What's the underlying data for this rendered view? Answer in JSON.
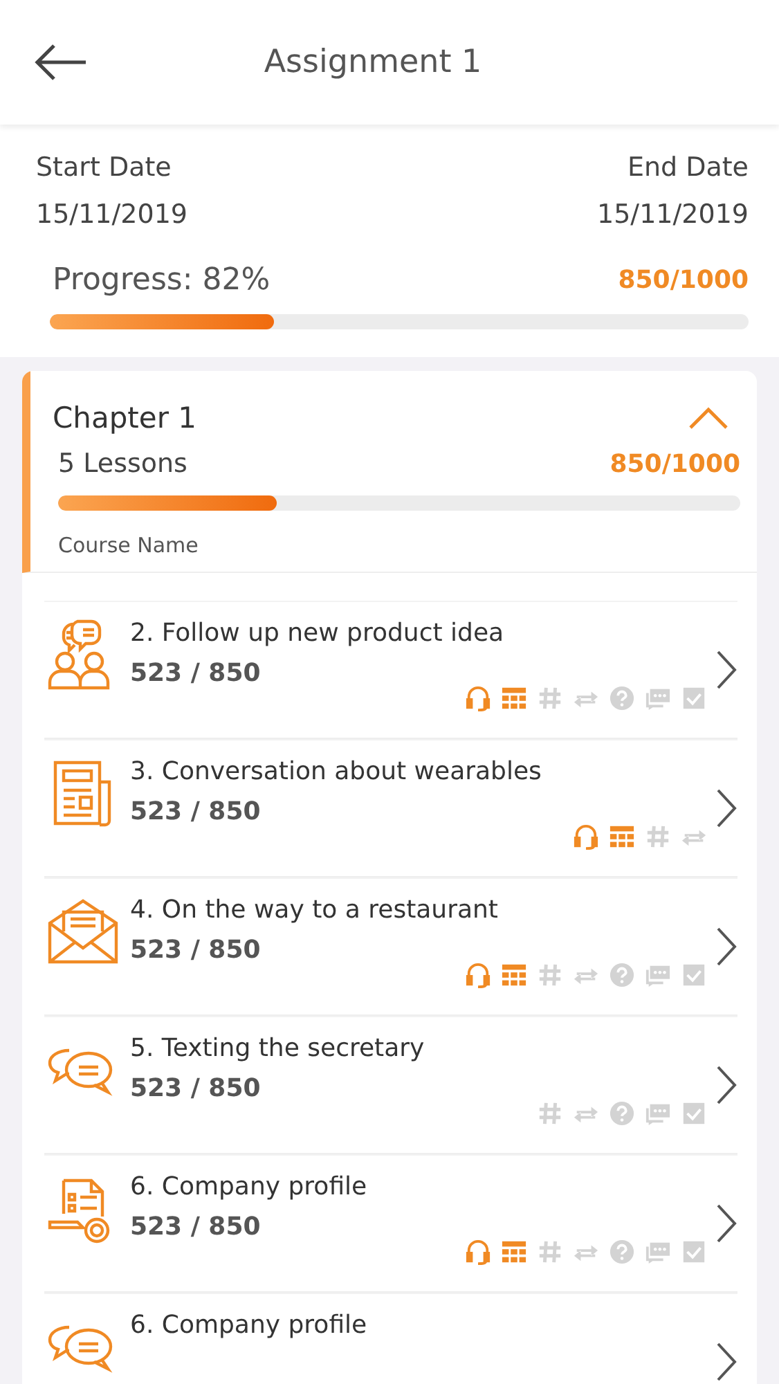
{
  "header": {
    "title": "Assignment 1"
  },
  "dates": {
    "start_label": "Start Date",
    "start_value": "15/11/2019",
    "end_label": "End Date",
    "end_value": "15/11/2019"
  },
  "progress": {
    "label": "Progress: 82%",
    "score": "850/1000",
    "level": 0.32
  },
  "chapter": {
    "title": "Chapter 1",
    "expanded": true,
    "lessons_count": "5 Lessons",
    "score": "850/1000",
    "level": 0.32,
    "course_name": "Course Name"
  },
  "lessons": [
    {
      "title": "2. Follow up new product idea",
      "score": "523 / 850",
      "kind": "people",
      "skills": [
        {
          "kind": "listening",
          "done": true
        },
        {
          "kind": "vocabulary",
          "done": true
        },
        {
          "kind": "hash",
          "done": false
        },
        {
          "kind": "swap",
          "done": false
        },
        {
          "kind": "quiz",
          "done": false
        },
        {
          "kind": "chat",
          "done": false
        },
        {
          "kind": "check",
          "done": false
        }
      ]
    },
    {
      "title": "3. Conversation about wearables",
      "score": "523 / 850",
      "kind": "newspaper",
      "skills": [
        {
          "kind": "listening",
          "done": true
        },
        {
          "kind": "vocabulary",
          "done": true
        },
        {
          "kind": "hash",
          "done": false
        },
        {
          "kind": "swap",
          "done": false
        }
      ]
    },
    {
      "title": "4. On the way to a restaurant",
      "score": "523 / 850",
      "kind": "envelope",
      "skills": [
        {
          "kind": "listening",
          "done": true
        },
        {
          "kind": "vocabulary",
          "done": true
        },
        {
          "kind": "hash",
          "done": false
        },
        {
          "kind": "swap",
          "done": false
        },
        {
          "kind": "quiz",
          "done": false
        },
        {
          "kind": "chat",
          "done": false
        },
        {
          "kind": "check",
          "done": false
        }
      ]
    },
    {
      "title": "5. Texting the secretary",
      "score": "523 / 850",
      "kind": "chat",
      "skills": [
        {
          "kind": "hash",
          "done": false
        },
        {
          "kind": "swap",
          "done": false
        },
        {
          "kind": "quiz",
          "done": false
        },
        {
          "kind": "chat",
          "done": false
        },
        {
          "kind": "check",
          "done": false
        }
      ]
    },
    {
      "title": "6. Company profile",
      "score": "523 / 850",
      "kind": "document",
      "skills": [
        {
          "kind": "listening",
          "done": true
        },
        {
          "kind": "vocabulary",
          "done": true
        },
        {
          "kind": "hash",
          "done": false
        },
        {
          "kind": "swap",
          "done": false
        },
        {
          "kind": "quiz",
          "done": false
        },
        {
          "kind": "chat",
          "done": false
        },
        {
          "kind": "check",
          "done": false
        }
      ]
    },
    {
      "title": "6. Company profile",
      "kind": "chat"
    }
  ]
}
